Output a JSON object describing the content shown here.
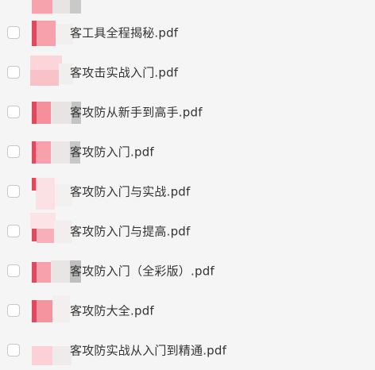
{
  "files": [
    {
      "name": "客工具全程揭秘.pdf"
    },
    {
      "name": "客攻击实战入门.pdf"
    },
    {
      "name": "客攻防从新手到高手.pdf"
    },
    {
      "name": "客攻防入门.pdf"
    },
    {
      "name": "客攻防入门与实战.pdf"
    },
    {
      "name": "客攻防入门与提高.pdf"
    },
    {
      "name": "客攻防入门（全彩版）.pdf"
    },
    {
      "name": "客攻防大全.pdf"
    },
    {
      "name": "客攻防实战从入门到精通.pdf"
    }
  ],
  "colors": {
    "pdf_accent": "#f26d7d",
    "text": "#333333",
    "background": "#f5f5f5"
  },
  "icons": {
    "file_type": "pdf-file-icon",
    "checkbox": "checkbox-icon"
  }
}
